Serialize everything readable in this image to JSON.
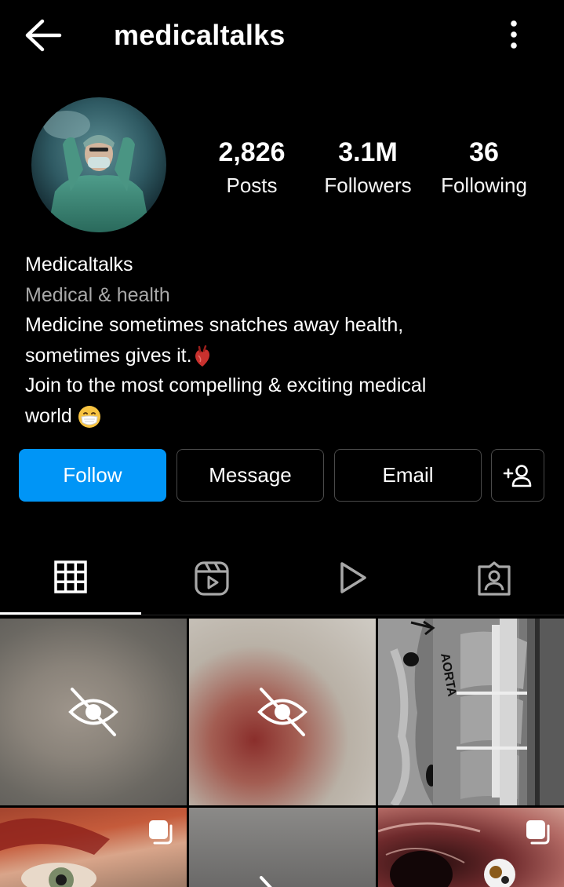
{
  "header": {
    "username": "medicaltalks"
  },
  "stats": {
    "posts_count": "2,826",
    "posts_label": "Posts",
    "followers_count": "3.1M",
    "followers_label": "Followers",
    "following_count": "36",
    "following_label": "Following"
  },
  "bio": {
    "name": "Medicaltalks",
    "category": "Medical & health",
    "line1": "Medicine sometimes snatches away health,",
    "line2": "sometimes gives it.",
    "line3": "Join to the most compelling & exciting medical",
    "line4": "world"
  },
  "actions": {
    "follow_label": "Follow",
    "message_label": "Message",
    "email_label": "Email"
  },
  "tabs": [
    {
      "icon": "grid-icon",
      "active": true
    },
    {
      "icon": "reels-icon",
      "active": false
    },
    {
      "icon": "video-play-icon",
      "active": false
    },
    {
      "icon": "tagged-icon",
      "active": false
    }
  ],
  "grid": {
    "post3_overlay_text": "AORTA"
  },
  "colors": {
    "background": "#000000",
    "follow_button": "#0095f6",
    "category_text": "#a8a8a8",
    "button_border": "#4a4a4a"
  }
}
